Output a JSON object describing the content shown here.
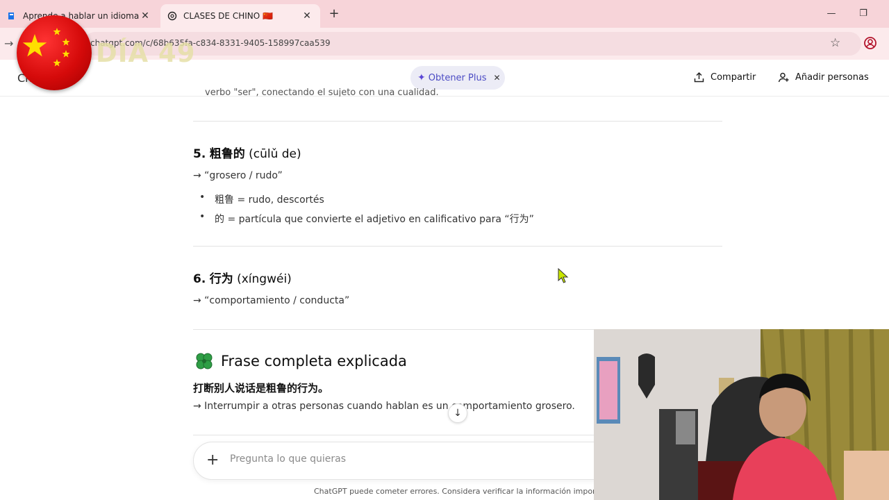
{
  "browser": {
    "tabs": [
      {
        "title": "Aprende a hablar un idioma de",
        "active": false,
        "favicon": "duolingo-icon"
      },
      {
        "title": "CLASES DE CHINO 🇨🇳",
        "active": true,
        "favicon": "openai-icon"
      }
    ],
    "url": "chatgpt.com/c/68b635fa-c834-8331-9405-158997caa539",
    "colors": {
      "tabbar": "#f7d4d9",
      "toolbar": "#fceaec"
    }
  },
  "overlay": {
    "day_label": "DÍA 49"
  },
  "header": {
    "model": "Ch",
    "plus_button": "Obtener Plus",
    "share": "Compartir",
    "add_people": "Añadir personas"
  },
  "content": {
    "clipped_line": "verbo \"ser\", conectando el sujeto con una cualidad.",
    "item5": {
      "number": "5.",
      "hanzi": "粗鲁的",
      "pinyin": "(cūlǔ de)",
      "meaning": "→ “grosero / rudo”",
      "bullets": [
        "粗鲁 = rudo, descortés",
        "的 = partícula que convierte el adjetivo en calificativo para “行为”"
      ]
    },
    "item6": {
      "number": "6.",
      "hanzi": "行为",
      "pinyin": "(xíngwéi)",
      "meaning": "→ “comportamiento / conducta”"
    },
    "full_sentence": {
      "title": "Frase completa explicada",
      "chinese": "打断别人说话是粗鲁的行为。",
      "translation": "→ Interrumpir a otras personas cuando hablan es un comportamiento grosero."
    }
  },
  "composer": {
    "placeholder": "Pregunta lo que quieras"
  },
  "footer": {
    "note": "ChatGPT puede cometer errores. Considera verificar la información importante."
  }
}
